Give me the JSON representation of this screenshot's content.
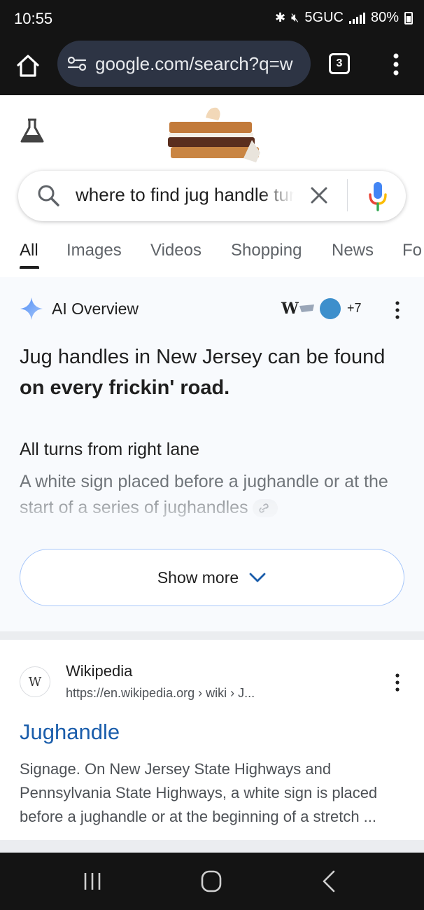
{
  "status_bar": {
    "time": "10:55",
    "network": "5GUC",
    "battery": "80%"
  },
  "browser": {
    "url": "google.com/search?q=w",
    "tab_count": "3"
  },
  "search": {
    "query": "where to find jug handle turns"
  },
  "tabs": [
    {
      "label": "All"
    },
    {
      "label": "Images"
    },
    {
      "label": "Videos"
    },
    {
      "label": "Shopping"
    },
    {
      "label": "News"
    },
    {
      "label": "Fo"
    }
  ],
  "ai_overview": {
    "title": "AI Overview",
    "source_logo_text": "W",
    "more_sources": "+7",
    "answer_plain": "Jug handles in New Jersey can be found ",
    "answer_bold": "on every frickin' road.",
    "subheading": "All turns from right lane",
    "detail": "A white sign placed before a jughandle or at the start of a series of jughandles",
    "show_more": "Show more"
  },
  "result": {
    "favicon_text": "W",
    "site_name": "Wikipedia",
    "url": "https://en.wikipedia.org › wiki › J...",
    "title": "Jughandle",
    "snippet": "Signage. On New Jersey State Highways and Pennsylvania State Highways, a white sign is placed before a jughandle or at the beginning of a stretch ..."
  },
  "colors": {
    "browser_chrome": "#141414",
    "url_pill": "#2d3444",
    "link_blue": "#1a5dab",
    "ai_panel_bg": "#f8fafd",
    "show_more_border": "#a8c7fa"
  }
}
